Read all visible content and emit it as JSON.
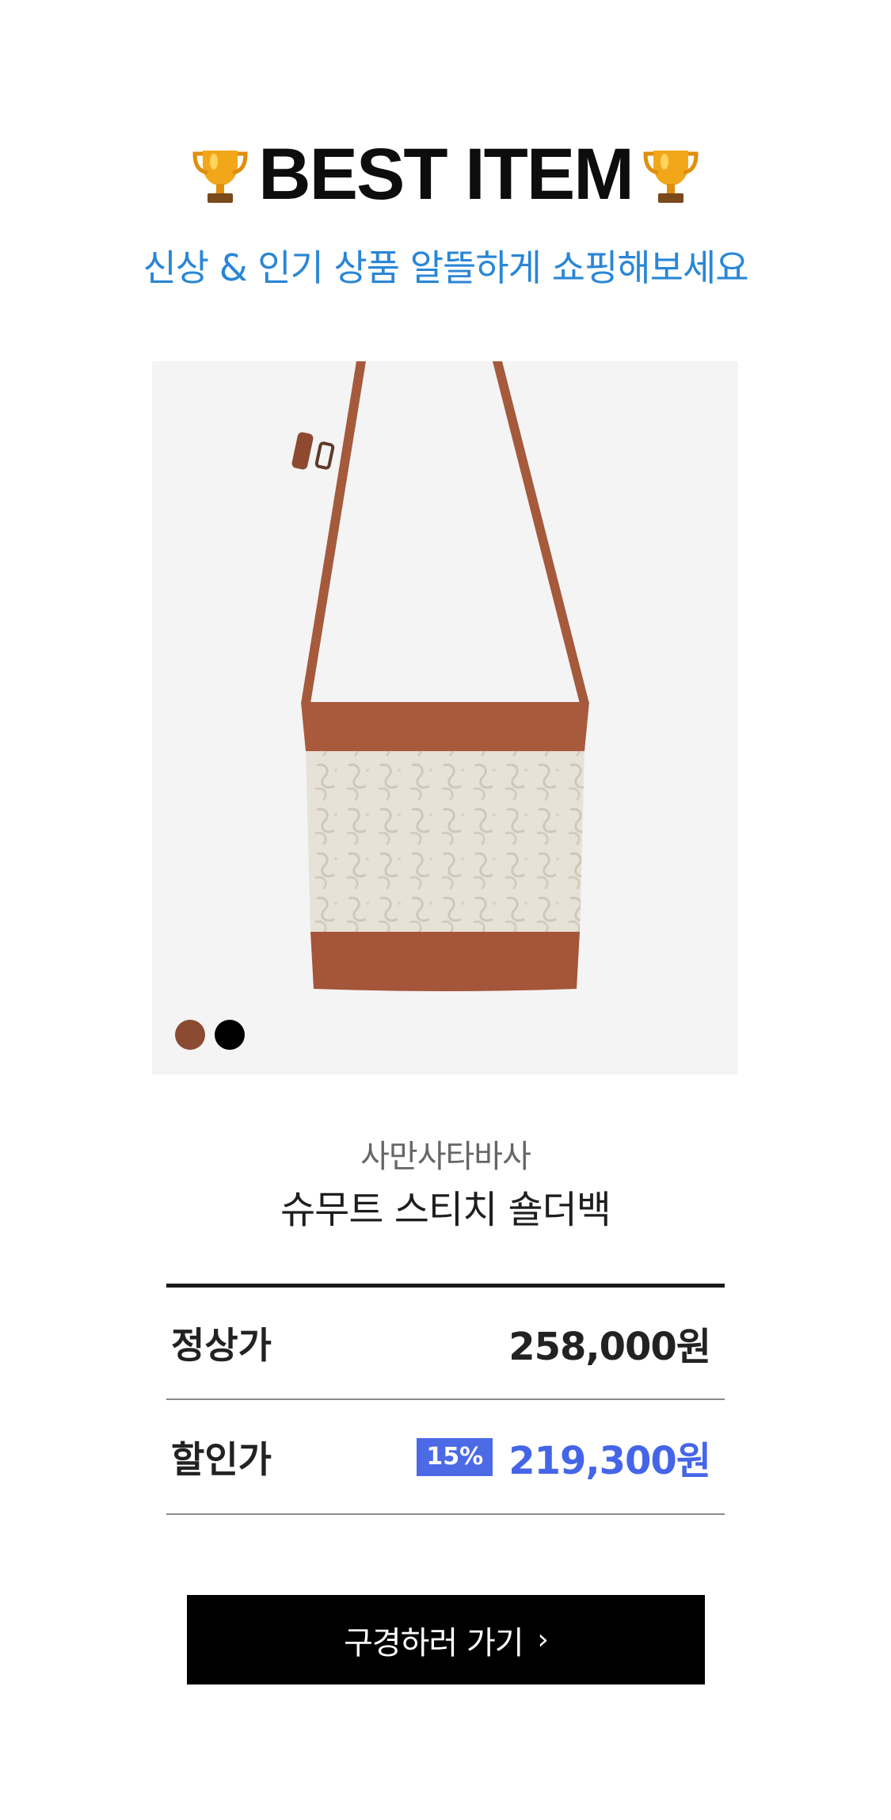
{
  "header": {
    "title": "BEST ITEM",
    "subtitle": "신상 & 인기 상품 알뜰하게 쇼핑해보세요",
    "left_icon": "trophy-icon",
    "right_icon": "trophy-icon"
  },
  "product": {
    "brand": "사만사타바사",
    "name": "슈무트 스티치 숄더백",
    "color_swatches": [
      {
        "name": "brown",
        "color": "#8b4a32"
      },
      {
        "name": "black",
        "color": "#000000"
      }
    ]
  },
  "price": {
    "regular_label": "정상가",
    "regular_value": "258,000원",
    "sale_label": "할인가",
    "discount": "15%",
    "sale_value": "219,300원"
  },
  "cta": {
    "label": "구경하러 가기",
    "chevron": "›"
  },
  "colors": {
    "accent_blue": "#2a86d6",
    "sale_blue": "#4565e8",
    "badge_blue": "#4d6ae6",
    "bag_leather": "#a95a3d"
  }
}
